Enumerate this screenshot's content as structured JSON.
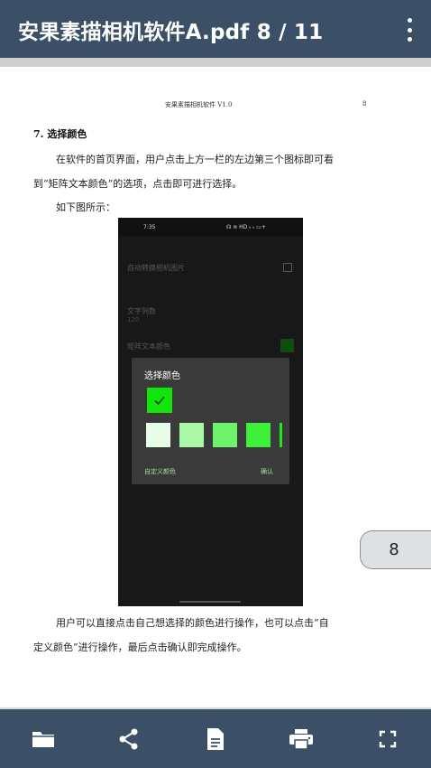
{
  "topbar": {
    "title": "安果素描相机软件A.pdf  8 / 11"
  },
  "page": {
    "header_title": "安果素描相机软件 V1.0",
    "header_page": "8",
    "section_heading": "7. 选择颜色",
    "para1_line1": "在软件的首页界面，用户点击上方一栏的左边第三个图标即可看",
    "para1_line2": "到“矩阵文本颜色”的选项，点击即可进行选择。",
    "para2": "如下图所示：",
    "para3_line1": "用户可以直接点击自己想选择的颜色进行操作，也可以点击“自",
    "para3_line2": "定义颜色”进行操作，最后点击确认即完成操作。"
  },
  "phone_screenshot": {
    "time": "7:35",
    "status_icons": "☊ ≋ HD ᵢₗ ᵢₗ ▭+",
    "row1": "自动转换相机图片",
    "row2_label": "文字列数",
    "row2_value": "120",
    "row3": "矩阵文本颜色",
    "dialog": {
      "title": "选择颜色",
      "custom_button": "自定义颜色",
      "confirm_button": "确认",
      "selected_color": "#11e60b",
      "swatches": [
        "#e8fde8",
        "#a9f9a6",
        "#6df46a",
        "#3ff03a",
        "#1de818"
      ]
    }
  },
  "page_chip": "8",
  "toolbar": {
    "icons": [
      "folder-icon",
      "share-icon",
      "document-icon",
      "print-icon",
      "fullscreen-icon"
    ]
  },
  "colors": {
    "bar": "#3b5066",
    "accent_green": "#11e60b"
  }
}
